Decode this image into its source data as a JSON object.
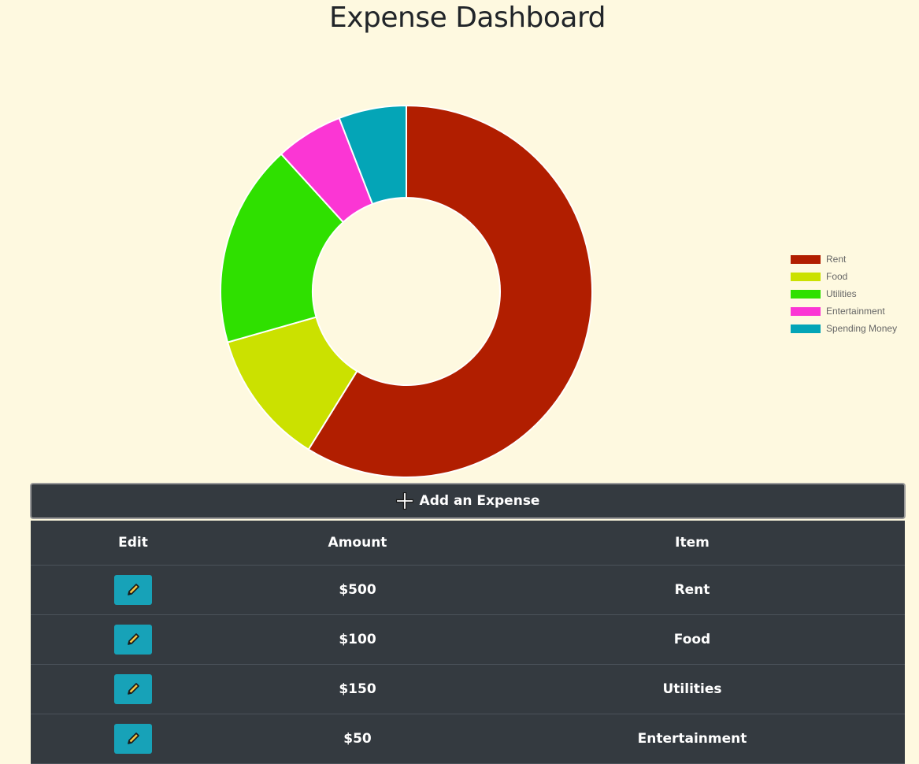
{
  "page": {
    "title": "Expense Dashboard"
  },
  "chart_data": {
    "type": "pie",
    "variant": "doughnut",
    "categories": [
      "Rent",
      "Food",
      "Utilities",
      "Entertainment",
      "Spending Money"
    ],
    "values": [
      500,
      100,
      150,
      50,
      50
    ],
    "colors": [
      "#b11e00",
      "#cbe100",
      "#2fe000",
      "#fb36d4",
      "#04a5b7"
    ],
    "legend_position": "right"
  },
  "actions": {
    "add_label": "Add an Expense",
    "add_icon": "plus-icon"
  },
  "table": {
    "headers": {
      "edit": "Edit",
      "amount": "Amount",
      "item": "Item"
    },
    "edit_icon": "pencil-icon",
    "rows": [
      {
        "amount": "$500",
        "item": "Rent"
      },
      {
        "amount": "$100",
        "item": "Food"
      },
      {
        "amount": "$150",
        "item": "Utilities"
      },
      {
        "amount": "$50",
        "item": "Entertainment"
      }
    ]
  }
}
